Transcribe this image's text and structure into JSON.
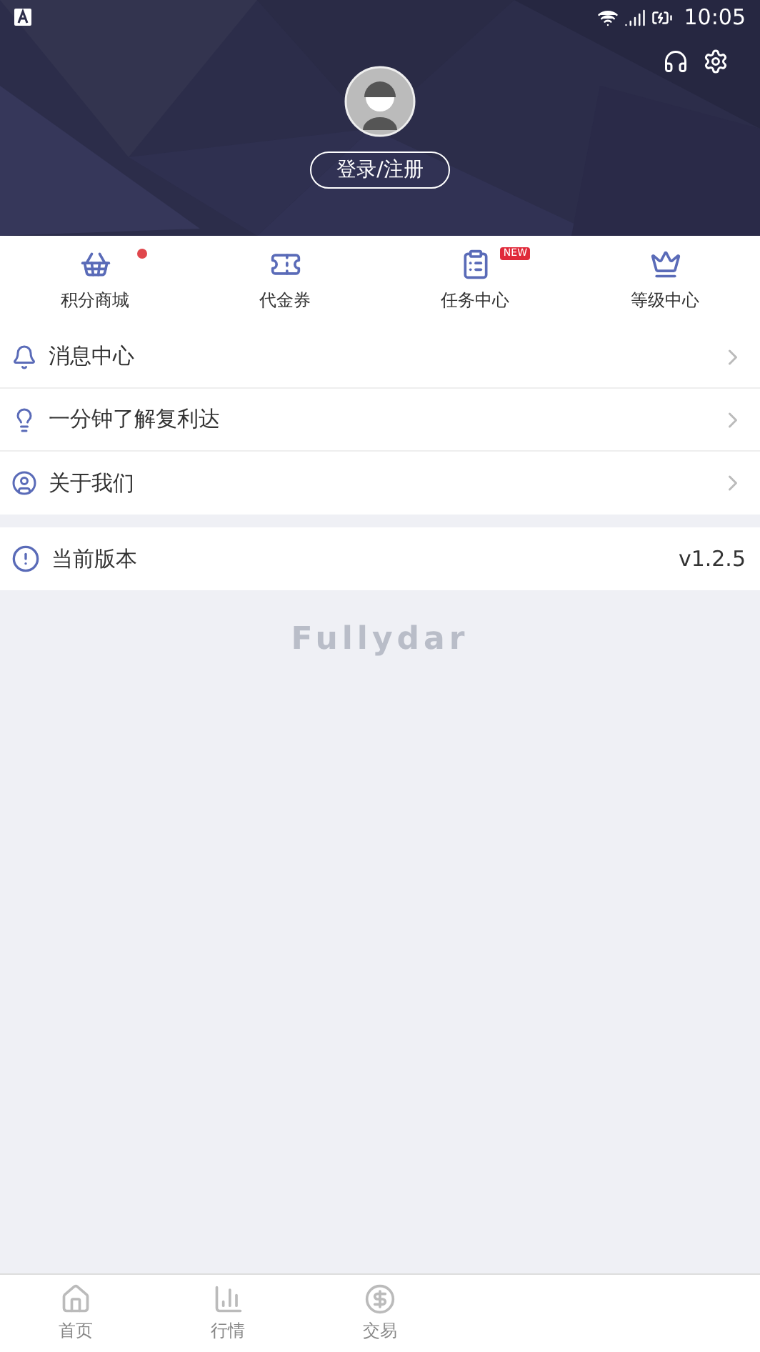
{
  "status_bar": {
    "time": "10:05"
  },
  "header": {
    "login_button": "登录/注册"
  },
  "quick_links": [
    {
      "label": "积分商城",
      "kind": "dot"
    },
    {
      "label": "代金券",
      "kind": "plain"
    },
    {
      "label": "任务中心",
      "kind": "tag",
      "badge_label": "NEW"
    },
    {
      "label": "等级中心",
      "kind": "plain"
    }
  ],
  "menu": [
    {
      "label": "消息中心"
    },
    {
      "label": "一分钟了解复利达"
    },
    {
      "label": "关于我们"
    }
  ],
  "version": {
    "label": "当前版本",
    "value": "v1.2.5"
  },
  "brand_text": "Fullydar",
  "bottom_nav": [
    {
      "label": "首页",
      "selected": false
    },
    {
      "label": "行情",
      "selected": false
    },
    {
      "label": "交易",
      "selected": false
    }
  ]
}
